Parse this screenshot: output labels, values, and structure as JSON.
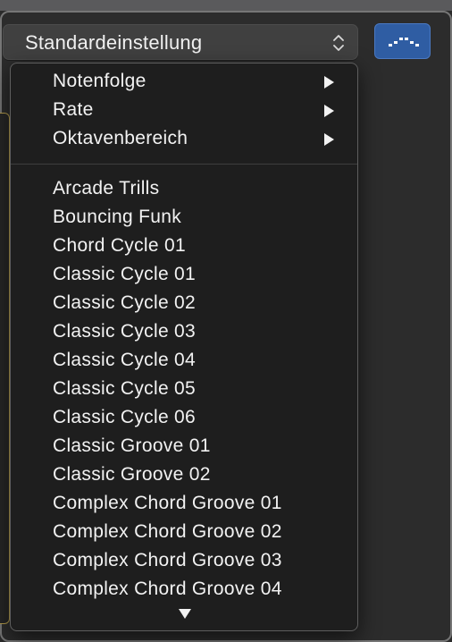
{
  "popup": {
    "selected": "Standardeinstellung"
  },
  "menu": {
    "submenus": [
      {
        "label": "Notenfolge"
      },
      {
        "label": "Rate"
      },
      {
        "label": "Oktavenbereich"
      }
    ],
    "presets": [
      "Arcade Trills",
      "Bouncing Funk",
      "Chord Cycle 01",
      "Classic Cycle 01",
      "Classic Cycle 02",
      "Classic Cycle 03",
      "Classic Cycle 04",
      "Classic Cycle 05",
      "Classic Cycle 06",
      "Classic Groove 01",
      "Classic Groove 02",
      "Complex Chord Groove 01",
      "Complex Chord Groove 02",
      "Complex Chord Groove 03",
      "Complex Chord Groove 04"
    ]
  },
  "icons": {
    "popup_indicator": "up-down-chevron-icon",
    "mode_button": "arpeggio-pattern-icon",
    "submenu_arrow": "submenu-arrow-icon",
    "scroll": "scroll-down-arrow-icon"
  },
  "colors": {
    "accent": "#2f5da3",
    "menu_bg": "#1e1e1e",
    "panel_border": "#b29a4b"
  }
}
